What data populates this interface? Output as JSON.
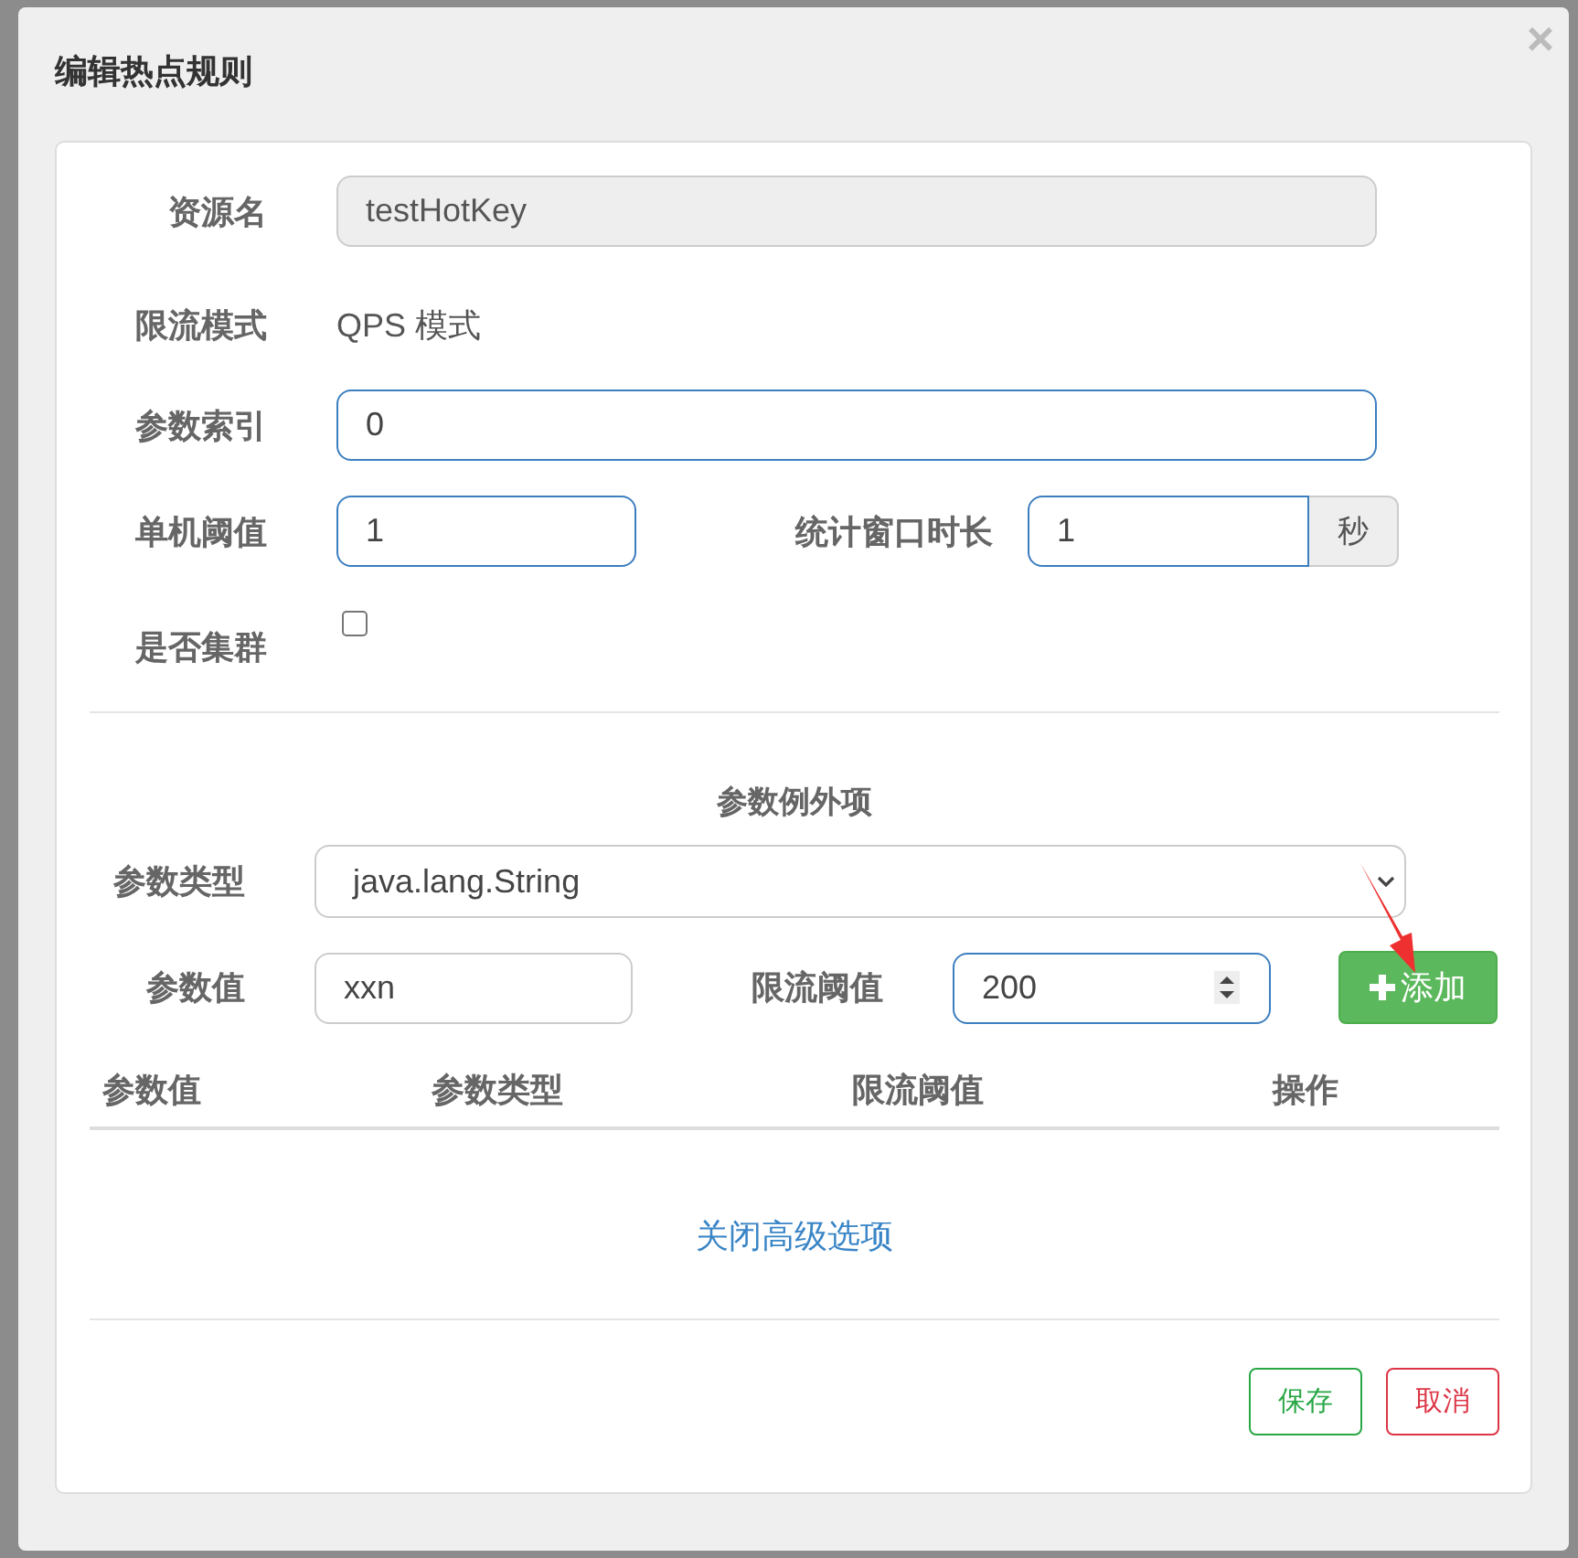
{
  "dialog": {
    "title": "编辑热点规则",
    "close": "×"
  },
  "rule": {
    "resource": {
      "label": "资源名",
      "value": "testHotKey",
      "disabled": true
    },
    "mode": {
      "label": "限流模式",
      "value": "QPS 模式"
    },
    "param_index": {
      "label": "参数索引",
      "value": "0"
    },
    "threshold": {
      "label": "单机阈值",
      "value": "1"
    },
    "window": {
      "label": "统计窗口时长",
      "value": "1",
      "unit": "秒"
    },
    "cluster": {
      "label": "是否集群",
      "checked": false
    }
  },
  "exceptions": {
    "title": "参数例外项",
    "param_type": {
      "label": "参数类型",
      "value": "java.lang.String"
    },
    "param_value": {
      "label": "参数值",
      "value": "xxn"
    },
    "limit": {
      "label": "限流阈值",
      "value": "200"
    },
    "add_button": "添加",
    "columns": [
      "参数值",
      "参数类型",
      "限流阈值",
      "操作"
    ]
  },
  "toggle_link": "关闭高级选项",
  "buttons": [
    {
      "label": "保存",
      "kind": "save"
    },
    {
      "label": "取消",
      "kind": "cancel"
    }
  ]
}
